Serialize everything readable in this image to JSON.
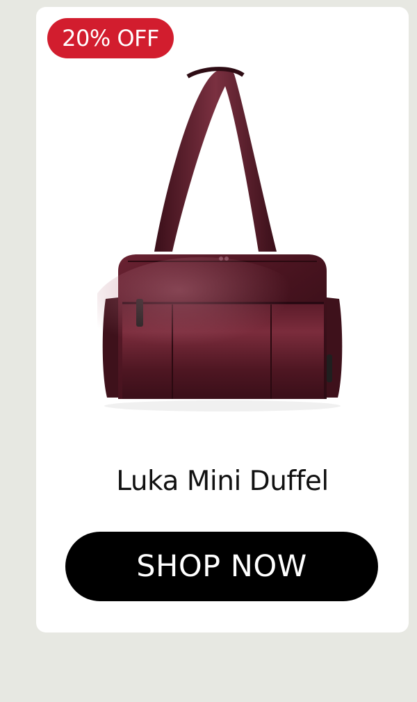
{
  "badge": {
    "label": "20% OFF",
    "color": "#d21d2e"
  },
  "product": {
    "name": "Luka Mini Duffel",
    "image_subject": "duffel-bag-image",
    "bag_color": "#4a1420"
  },
  "cta": {
    "label": "SHOP NOW"
  },
  "colors": {
    "background": "#e7e8e2",
    "card": "#ffffff",
    "button": "#000000",
    "button_text": "#ffffff"
  }
}
